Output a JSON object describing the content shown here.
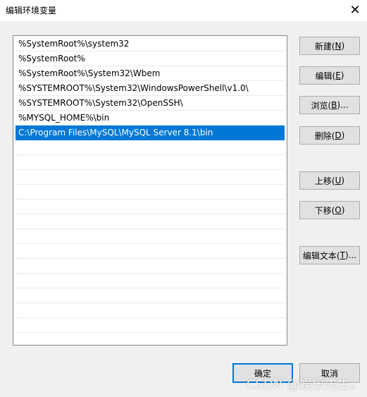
{
  "window": {
    "title": "编辑环境变量",
    "close_glyph": "✕"
  },
  "list": {
    "items": [
      "%SystemRoot%\\system32",
      "%SystemRoot%",
      "%SystemRoot%\\System32\\Wbem",
      "%SYSTEMROOT%\\System32\\WindowsPowerShell\\v1.0\\",
      "%SYSTEMROOT%\\System32\\OpenSSH\\",
      "%MYSQL_HOME%\\bin",
      "C:\\Program Files\\MySQL\\MySQL Server 8.1\\bin"
    ],
    "selected_index": 6,
    "selection_color": "#0078d7"
  },
  "buttons": {
    "new": {
      "label": "新建(",
      "key": "N",
      "suffix": ")"
    },
    "edit": {
      "label": "编辑(",
      "key": "E",
      "suffix": ")"
    },
    "browse": {
      "label": "浏览(",
      "key": "B",
      "suffix": ")..."
    },
    "delete": {
      "label": "删除(",
      "key": "D",
      "suffix": ")"
    },
    "move_up": {
      "label": "上移(",
      "key": "U",
      "suffix": ")"
    },
    "move_down": {
      "label": "下移(",
      "key": "O",
      "suffix": ")"
    },
    "edit_text": {
      "label": "编辑文本(",
      "key": "T",
      "suffix": ")..."
    },
    "ok": {
      "label": "确定"
    },
    "cancel": {
      "label": "取消"
    }
  },
  "watermark": "CSDN @娱乐先生。"
}
